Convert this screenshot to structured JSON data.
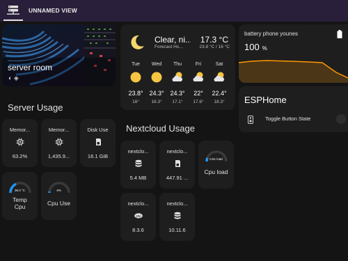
{
  "header": {
    "view_title": "UNNAMED VIEW",
    "tab_icon": "server-network-icon"
  },
  "picture_card": {
    "title": "server room",
    "icons": "◐ ◈",
    "toggle_icon": "toggle-switch-icon"
  },
  "server_usage": {
    "title": "Server Usage",
    "tiles": [
      {
        "name": "Memor...",
        "icon": "chip-icon",
        "value": "63.2%"
      },
      {
        "name": "Memor...",
        "icon": "chip-icon",
        "value": "1,435.9..."
      },
      {
        "name": "Disk Use",
        "icon": "sd-card-icon",
        "value": "16.1 GiB"
      }
    ],
    "gauges": [
      {
        "label_line1": "Temp",
        "label_line2": "Cpu",
        "value_text": "36.0 °C",
        "level": 0.36,
        "color": "#2196f3"
      },
      {
        "label_line1": "Cpu Use",
        "label_line2": "",
        "value_text": "4%",
        "level": 0.04,
        "color": "#2196f3"
      }
    ]
  },
  "weather": {
    "condition": "Clear, ni...",
    "subtitle": "Forecast Ho...",
    "temperature": "17.3 °C",
    "range": "23.8 °C / 16 °C",
    "forecast": [
      {
        "day": "Tue",
        "icon": "sun-icon",
        "high": "23.8°",
        "low": "16°"
      },
      {
        "day": "Wed",
        "icon": "sun-icon",
        "high": "24.3°",
        "low": "16.3°"
      },
      {
        "day": "Thu",
        "icon": "cloud-sun-icon",
        "high": "24.3°",
        "low": "17.1°"
      },
      {
        "day": "Fri",
        "icon": "cloud-sun-icon",
        "high": "22°",
        "low": "17.6°"
      },
      {
        "day": "Sat",
        "icon": "cloud-sun-icon",
        "high": "22.4°",
        "low": "18.3°"
      }
    ]
  },
  "battery": {
    "name": "battery phone younes",
    "value": "100",
    "unit": "%",
    "icon": "battery-full-icon",
    "graph_color": "#ff9800"
  },
  "esphome": {
    "title": "ESPHome",
    "entity_label": "Toggle Button State",
    "entity_icon": "remote-icon"
  },
  "nextcloud_usage": {
    "title": "Nextcloud Usage",
    "tiles": [
      {
        "name": "nextclo...",
        "icon": "database-icon",
        "value": "5.4 MB"
      },
      {
        "name": "nextclo...",
        "icon": "sd-card-icon",
        "value": "447.91 ..."
      },
      {
        "name": "nextclo...",
        "icon": "php-icon",
        "value": "8.3.6"
      },
      {
        "name": "nextclo...",
        "icon": "database-icon",
        "value": "10.11.6"
      }
    ],
    "gauge": {
      "label": "Cpu load",
      "value_text": "0.61 load",
      "level": 0.12,
      "color": "#2196f3"
    }
  }
}
